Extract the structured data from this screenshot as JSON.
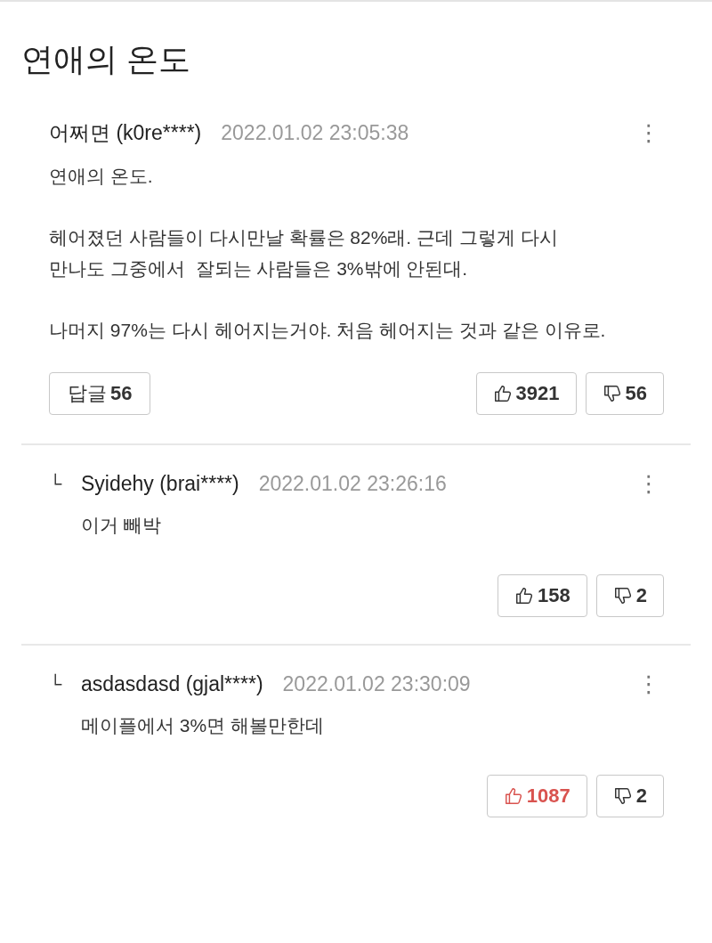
{
  "title": "연애의 온도",
  "comments": [
    {
      "kind": "comment",
      "author": "어쩌면 (k0re****)",
      "time": "2022.01.02 23:05:38",
      "menu": "⋮",
      "paragraphs": [
        "연애의 온도.",
        "헤어졌던 사람들이 다시만날 확률은 82%래. 근데 그렇게 다시\n만나도 그중에서  잘되는 사람들은 3%밖에 안된대.",
        "나머지 97%는 다시 헤어지는거야. 처음 헤어지는 것과 같은 이유로."
      ],
      "reply_label": "답글",
      "reply_count": "56",
      "likes": "3921",
      "liked": false,
      "dislikes": "56"
    },
    {
      "kind": "reply",
      "marker": "└",
      "author": "Syidehy (brai****)",
      "time": "2022.01.02 23:26:16",
      "menu": "⋮",
      "paragraphs": [
        "이거 빼박"
      ],
      "likes": "158",
      "liked": false,
      "dislikes": "2"
    },
    {
      "kind": "reply",
      "marker": "└",
      "author": "asdasdasd (gjal****)",
      "time": "2022.01.02 23:30:09",
      "menu": "⋮",
      "paragraphs": [
        "메이플에서 3%면 해볼만한데"
      ],
      "likes": "1087",
      "liked": true,
      "dislikes": "2"
    }
  ]
}
